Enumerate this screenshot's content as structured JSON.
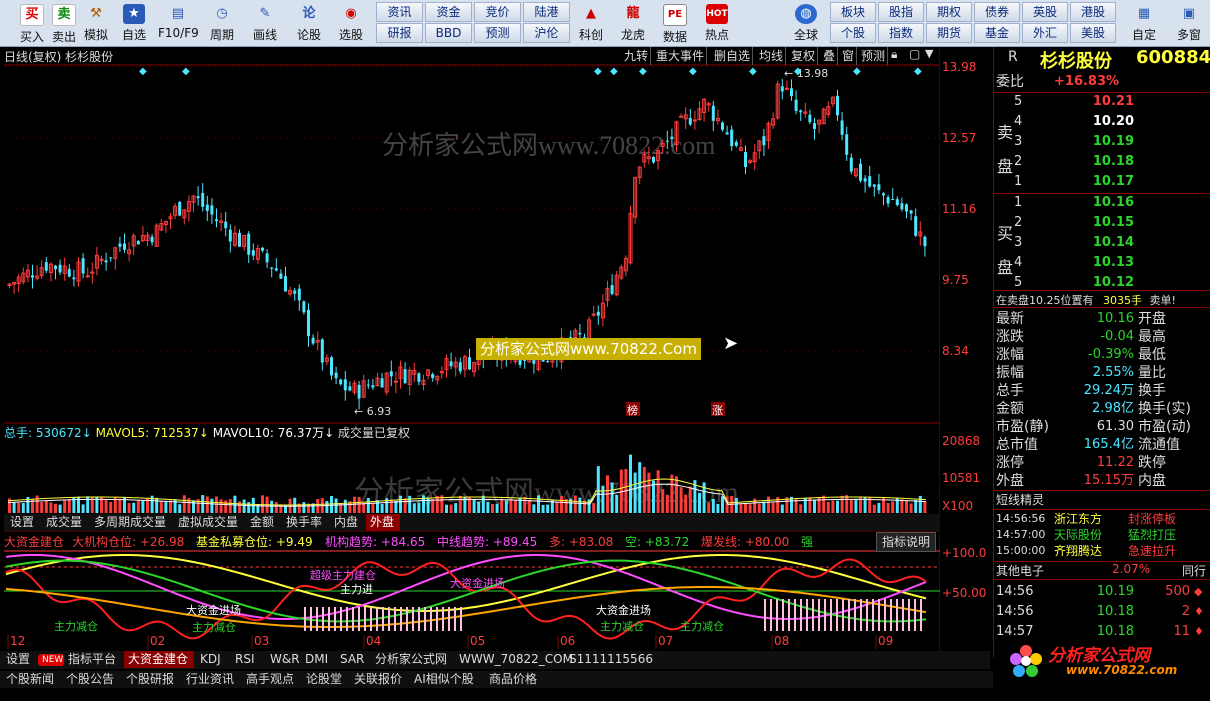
{
  "toolbar": {
    "buttons": [
      {
        "label": "买入",
        "icon": "buy-icon",
        "glyph": "买",
        "color": "#e00000"
      },
      {
        "label": "卖出",
        "icon": "sell-icon",
        "glyph": "卖",
        "color": "#0a8a0a"
      },
      {
        "label": "模拟",
        "icon": "hammer-icon",
        "glyph": "⚒",
        "color": "#b05a00"
      },
      {
        "label": "自选",
        "icon": "star-icon",
        "glyph": "★",
        "color": "#2a5ab8"
      },
      {
        "label": "F10/F9",
        "icon": "f10-icon",
        "glyph": "▤",
        "color": "#2a5ab8"
      },
      {
        "label": "周期",
        "icon": "clock-icon",
        "glyph": "◷",
        "color": "#2a5ab8"
      },
      {
        "label": "画线",
        "icon": "pencil-icon",
        "glyph": "✎",
        "color": "#2a5ab8"
      },
      {
        "label": "论股",
        "icon": "discuss-icon",
        "glyph": "论",
        "color": "#2a5ab8"
      },
      {
        "label": "选股",
        "icon": "select-icon",
        "glyph": "◉",
        "color": "#d00000"
      }
    ],
    "grid_row1": [
      "资讯",
      "资金",
      "竞价",
      "陆港"
    ],
    "grid_row2": [
      "研报",
      "BBD",
      "预测",
      "沪伦"
    ],
    "icons2": [
      {
        "label": "科创",
        "icon": "chart-icon",
        "glyph": "▲"
      },
      {
        "label": "龙虎",
        "icon": "dragon-icon",
        "glyph": "龍"
      },
      {
        "label": "数据",
        "icon": "pe-icon",
        "glyph": "PE"
      },
      {
        "label": "热点",
        "icon": "hot-icon",
        "glyph": "HOT"
      }
    ],
    "globe_label": "全球",
    "grid2_row1": [
      "板块",
      "股指",
      "期权",
      "债券",
      "英股",
      "港股"
    ],
    "grid2_row2": [
      "个股",
      "指数",
      "期货",
      "基金",
      "外汇",
      "美股"
    ],
    "extra": [
      "自定",
      "多窗"
    ]
  },
  "chart": {
    "title": "日线(复权) 杉杉股份",
    "menu": [
      "九转",
      "重大事件",
      "删自选",
      "均线",
      "复权",
      "叠",
      "窗",
      "预测"
    ],
    "price_ticks": [
      "13.98",
      "12.57",
      "11.16",
      "9.75",
      "8.34"
    ],
    "high_label": "13.98",
    "low_label": "6.93",
    "watermark1": "分析家公式网www.70822.com",
    "watermark_overlay": "分析家公式网www.70822.Com",
    "markers": [
      "榜",
      "涨"
    ],
    "volume_header": {
      "total_label": "总手: 530672",
      "mavol5": "MAVOL5: 712537",
      "mavol10": "MAVOL10: 76.37万",
      "note": "成交量已复权"
    },
    "volume_ticks": [
      "20868",
      "10581",
      "X100"
    ],
    "vol_tabs": [
      "设置",
      "成交量",
      "多周期成交量",
      "虚拟成交量",
      "金额",
      "换手率",
      "内盘",
      "外盘"
    ],
    "indicator_header": [
      {
        "text": "大资金建仓",
        "color": "#ff3c3c"
      },
      {
        "text": "大机构仓位: +26.98",
        "color": "#ff3c3c"
      },
      {
        "text": "基金私募仓位: +9.49",
        "color": "#ffff3c"
      },
      {
        "text": "机构趋势: +84.65",
        "color": "#ff4dff"
      },
      {
        "text": "中线趋势: +89.45",
        "color": "#ff4dff"
      },
      {
        "text": "多: +83.08",
        "color": "#ff3c3c"
      },
      {
        "text": "空: +83.72",
        "color": "#2bd62b"
      },
      {
        "text": "爆发线: +80.00",
        "color": "#ff3c3c"
      },
      {
        "text": "强",
        "color": "#2bd62b"
      }
    ],
    "indicator_btn": "指标说明",
    "indicator_ticks": [
      "+100.0",
      "+50.00"
    ],
    "indicator_labels": [
      "超级主力建仓",
      "主力进",
      "大资金进场",
      "大资金进场",
      "大资金进场",
      "主力减仓",
      "主力减仓",
      "主力减仓",
      "主力减仓"
    ],
    "months": [
      "12",
      "02",
      "03",
      "04",
      "05",
      "06",
      "07",
      "08",
      "09"
    ],
    "bottom_tabs": [
      "设置",
      "NEW",
      "指标平台",
      "大资金建仓",
      "KDJ",
      "RSI",
      "W&R",
      "DMI",
      "SAR",
      "分析家公式网",
      "WWW_70822_COM",
      "S1111115566"
    ],
    "news_tabs": [
      "个股新闻",
      "个股公告",
      "个股研报",
      "行业资讯",
      "高手观点",
      "论股堂",
      "关联报价",
      "AI相似个股",
      "商品价格"
    ]
  },
  "quote": {
    "code_prefix": "R",
    "name": "杉杉股份",
    "code": "600884",
    "weibi_label": "委比",
    "weibi": "+16.83%",
    "sell_label": "卖盘",
    "buy_label": "买盘",
    "asks": [
      {
        "n": "5",
        "p": "10.21",
        "c": "#ff3c3c"
      },
      {
        "n": "4",
        "p": "10.20",
        "c": "#ffffff"
      },
      {
        "n": "3",
        "p": "10.19",
        "c": "#2bd62b"
      },
      {
        "n": "2",
        "p": "10.18",
        "c": "#2bd62b"
      },
      {
        "n": "1",
        "p": "10.17",
        "c": "#2bd62b"
      }
    ],
    "bids": [
      {
        "n": "1",
        "p": "10.16",
        "c": "#2bd62b"
      },
      {
        "n": "2",
        "p": "10.15",
        "c": "#2bd62b"
      },
      {
        "n": "3",
        "p": "10.14",
        "c": "#2bd62b"
      },
      {
        "n": "4",
        "p": "10.13",
        "c": "#2bd62b"
      },
      {
        "n": "5",
        "p": "10.12",
        "c": "#2bd62b"
      }
    ],
    "note": "在卖盘10.25位置有",
    "note_vol": "3035手",
    "note_sell": "卖单!",
    "stats": [
      {
        "l": "最新",
        "v": "10.16",
        "c": "#2bd62b",
        "r": "开盘"
      },
      {
        "l": "涨跌",
        "v": "-0.04",
        "c": "#2bd62b",
        "r": "最高"
      },
      {
        "l": "涨幅",
        "v": "-0.39%",
        "c": "#2bd62b",
        "r": "最低"
      },
      {
        "l": "振幅",
        "v": "2.55%",
        "c": "#4de6ff",
        "r": "量比"
      },
      {
        "l": "总手",
        "v": "29.24万",
        "c": "#4de6ff",
        "r": "换手"
      },
      {
        "l": "金额",
        "v": "2.98亿",
        "c": "#4de6ff",
        "r": "换手(实)"
      },
      {
        "l": "市盈(静)",
        "v": "61.30",
        "c": "#dddddd",
        "r": "市盈(动)"
      },
      {
        "l": "总市值",
        "v": "165.4亿",
        "c": "#4de6ff",
        "r": "流通值"
      },
      {
        "l": "涨停",
        "v": "11.22",
        "c": "#ff3c3c",
        "r": "跌停"
      },
      {
        "l": "外盘",
        "v": "15.15万",
        "c": "#ff3c3c",
        "r": "内盘"
      }
    ],
    "sprite_title": "短线精灵",
    "sprite": [
      {
        "t": "14:56:56",
        "name": "浙江东方",
        "evt": "封涨停板"
      },
      {
        "t": "14:57:00",
        "name": "天际股份",
        "evt": "猛烈打压"
      },
      {
        "t": "15:00:00",
        "name": "齐翔腾达",
        "evt": "急速拉升"
      }
    ],
    "sector_name": "其他电子",
    "sector_chg": "2.07%",
    "sector_more": "同行",
    "ticks": [
      {
        "t": "14:56",
        "p": "10.19",
        "v": "500",
        "d": "◆"
      },
      {
        "t": "14:56",
        "p": "10.18",
        "v": "2",
        "d": "♦"
      },
      {
        "t": "14:57",
        "p": "10.18",
        "v": "11",
        "d": "♦"
      }
    ],
    "logo_text": "分析家公式网",
    "logo_url": "www.70822.com"
  }
}
